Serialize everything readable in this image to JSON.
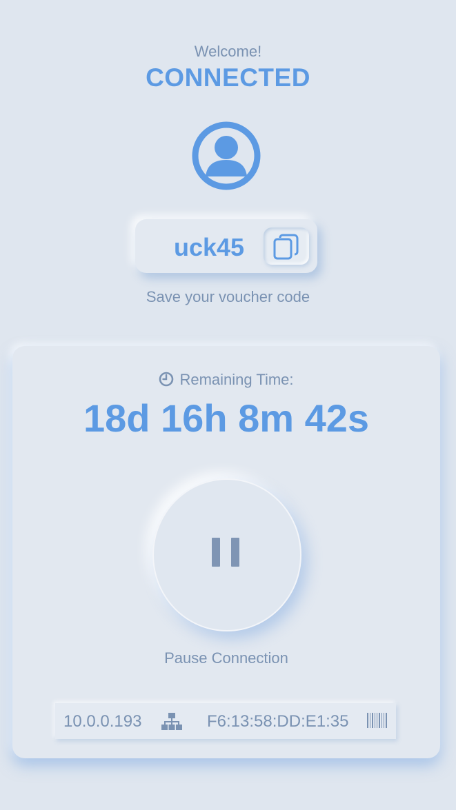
{
  "header": {
    "welcome": "Welcome!",
    "status": "CONNECTED"
  },
  "voucher": {
    "code": "uck45",
    "hint": "Save your voucher code"
  },
  "timer": {
    "label": "Remaining Time:",
    "value": "18d 16h 8m 42s"
  },
  "controls": {
    "pause_label": "Pause Connection"
  },
  "device": {
    "ip": "10.0.0.193",
    "mac": "F6:13:58:DD:E1:35"
  },
  "icons": {
    "avatar": "user-avatar-icon",
    "copy": "copy-icon",
    "clock": "clock-icon",
    "pause": "pause-icon",
    "network": "network-icon",
    "barcode": "barcode-icon"
  },
  "colors": {
    "accent": "#5c9ae3",
    "text_muted": "#7a92b2",
    "background": "#dfe6ef"
  }
}
